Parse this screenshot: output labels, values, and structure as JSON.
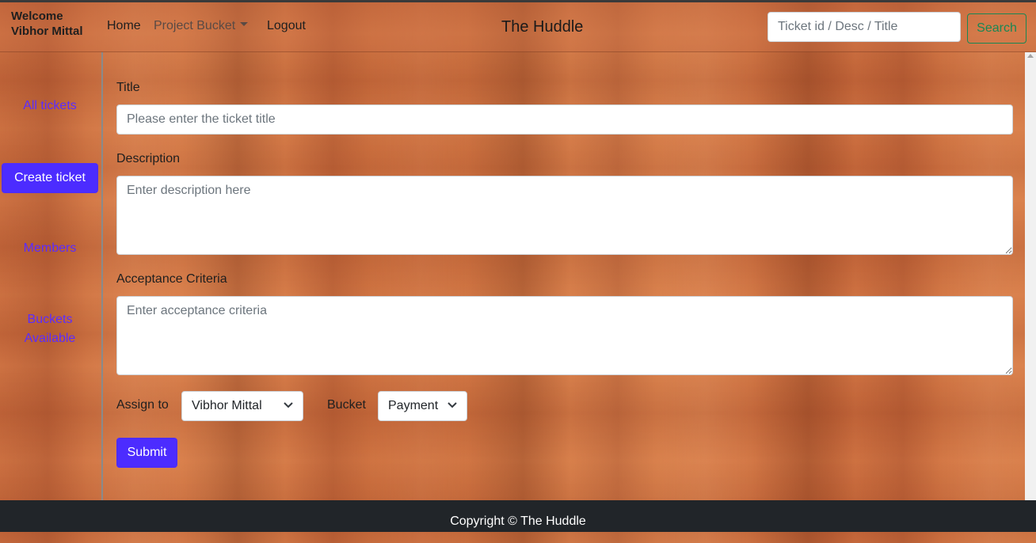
{
  "header": {
    "welcome_line1": "Welcome",
    "welcome_line2": "Vibhor Mittal",
    "nav": {
      "home": "Home",
      "project_bucket": "Project Bucket",
      "logout": "Logout"
    },
    "brand": "The Huddle",
    "search": {
      "placeholder": "Ticket id / Desc / Title",
      "button": "Search"
    }
  },
  "sidebar": {
    "items": [
      {
        "label": "All tickets",
        "active": false
      },
      {
        "label": "Create ticket",
        "active": true
      },
      {
        "label": "Members",
        "active": false
      },
      {
        "label": "Buckets Available",
        "active": false
      }
    ]
  },
  "form": {
    "title_label": "Title",
    "title_placeholder": "Please enter the ticket title",
    "description_label": "Description",
    "description_placeholder": "Enter description here",
    "acceptance_label": "Acceptance Criteria",
    "acceptance_placeholder": "Enter acceptance criteria",
    "assign_label": "Assign to",
    "assign_value": "Vibhor Mittal",
    "bucket_label": "Bucket",
    "bucket_value": "Payment",
    "submit": "Submit"
  },
  "footer": {
    "text": "Copyright © The Huddle"
  },
  "colors": {
    "primary": "#4c2cff",
    "success": "#198754",
    "footer_bg": "#212529"
  }
}
